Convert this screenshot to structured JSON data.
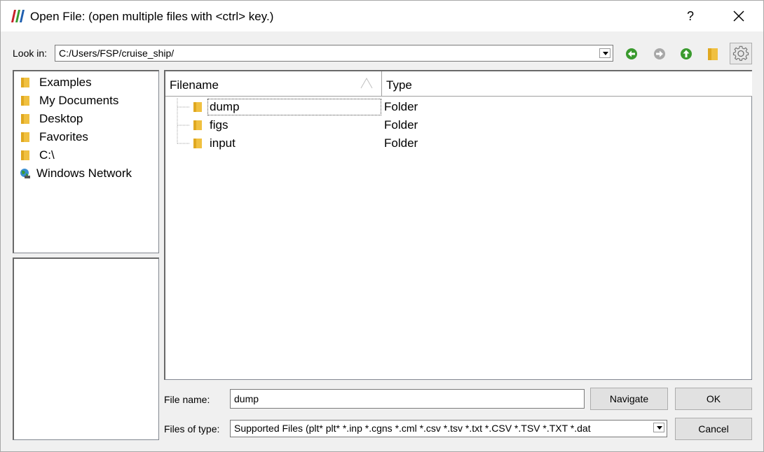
{
  "window": {
    "title": "Open File:  (open multiple files with <ctrl> key.)",
    "help_label": "?"
  },
  "lookin": {
    "label": "Look in:",
    "value": "C:/Users/FSP/cruise_ship/"
  },
  "toolbar": {
    "icons": [
      "back-arrow-icon",
      "forward-arrow-icon",
      "up-folder-icon",
      "new-folder-icon",
      "gear-icon"
    ],
    "colors": {
      "green": "#3a9a2e",
      "disabled": "#a8a8a8",
      "folder": "#f0c040"
    }
  },
  "places": [
    {
      "label": "Examples",
      "icon": "folder-icon"
    },
    {
      "label": "My Documents",
      "icon": "folder-icon"
    },
    {
      "label": "Desktop",
      "icon": "folder-icon"
    },
    {
      "label": "Favorites",
      "icon": "folder-icon"
    },
    {
      "label": "C:\\",
      "icon": "folder-icon"
    },
    {
      "label": "Windows Network",
      "icon": "network-globe-icon"
    }
  ],
  "filelist": {
    "columns": [
      "Filename",
      "Type"
    ],
    "rows": [
      {
        "name": "dump",
        "type": "Folder"
      },
      {
        "name": "figs",
        "type": "Folder"
      },
      {
        "name": "input",
        "type": "Folder"
      }
    ]
  },
  "bottom": {
    "filename_label": "File name:",
    "filename_value": "dump",
    "filetype_label": "Files of type:",
    "filetype_value": "Supported Files (plt* plt* *.inp *.cgns *.cml *.csv *.tsv *.txt *.CSV *.TSV *.TXT *.dat",
    "navigate_label": "Navigate",
    "ok_label": "OK",
    "cancel_label": "Cancel"
  }
}
